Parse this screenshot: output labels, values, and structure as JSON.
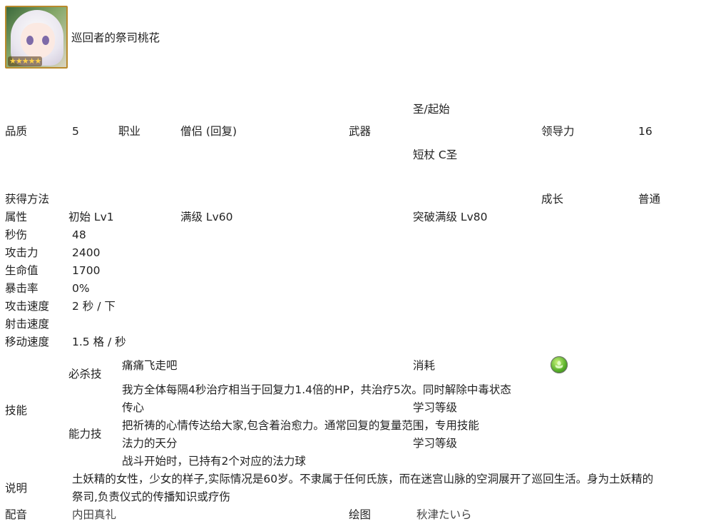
{
  "header": {
    "name": "巡回者的祭司桃花",
    "avatar_stars": "★★★★★"
  },
  "row_basic": {
    "quality_label": "品质",
    "quality_value": "5",
    "job_label": "职业",
    "job_value": "僧侣 (回复)",
    "weapon_label": "武器",
    "weapon_line1": "圣/起始",
    "weapon_line2": "短杖 C圣",
    "leadership_label": "领导力",
    "leadership_value": "16"
  },
  "row_obtain": {
    "obtain_label": "获得方法",
    "growth_label": "成长",
    "growth_value": "普通"
  },
  "attributes": {
    "label": "属性",
    "col_initial": "初始 Lv1",
    "col_max": "满级 Lv60",
    "col_limit_break": "突破满级 Lv80",
    "rows": [
      {
        "label": "秒伤",
        "value": "48"
      },
      {
        "label": "攻击力",
        "value": "2400"
      },
      {
        "label": "生命值",
        "value": "1700"
      },
      {
        "label": "暴击率",
        "value": "0%"
      },
      {
        "label": "攻击速度",
        "value": "2 秒 / 下"
      },
      {
        "label": "射击速度",
        "value": ""
      },
      {
        "label": "移动速度",
        "value": "1.5 格 / 秒"
      }
    ]
  },
  "skills": {
    "label": "技能",
    "special_label": "必杀技",
    "special_name": "痛痛飞走吧",
    "cost_label": "消耗",
    "cost_icon": "green-mana-orb-icon",
    "special_desc": "我方全体每隔4秒治疗相当于回复力1.4倍的HP，共治疗5次。同时解除中毒状态",
    "ability_label": "能力技",
    "abilities": [
      {
        "name": "传心",
        "learn_label": "学习等级",
        "desc": "把祈祷的心情传达给大家,包含着治愈力。通常回复的复量范围，专用技能"
      },
      {
        "name": "法力的天分",
        "learn_label": "学习等级",
        "desc": "战斗开始时，已持有2个对应的法力球"
      }
    ]
  },
  "description": {
    "label": "说明",
    "line1": " 土妖精的女性，少女的样子,实际情况是60岁。不隶属于任何氏族，而在迷宫山脉的空洞展开了巡回生活。身为土妖精的",
    "line2": "祭司,负责仪式的传播知识或疗伤"
  },
  "credits": {
    "voice_label": "配音",
    "voice_value": "内田真礼",
    "art_label": "绘图",
    "art_value": "秋津たいら"
  }
}
